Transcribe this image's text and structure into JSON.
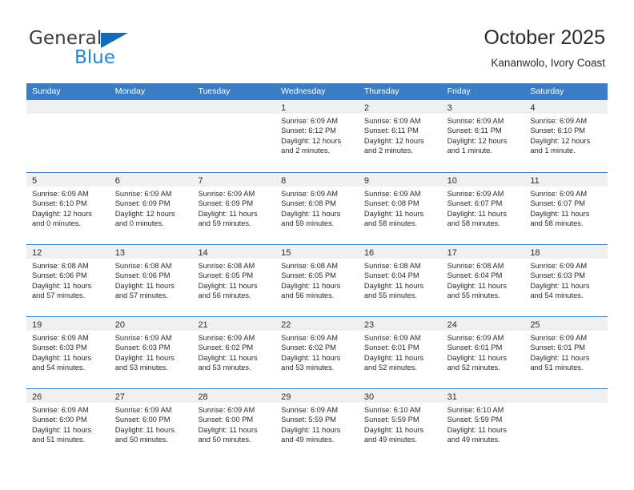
{
  "brand": {
    "name_top": "General",
    "name_bottom": "Blue",
    "triangle_color": "#0f6cb6",
    "blue_text_color": "#1f87d8"
  },
  "header": {
    "title": "October 2025",
    "subtitle": "Kananwolo, Ivory Coast"
  },
  "theme": {
    "header_blue": "#3b7dc4",
    "num_band_gray": "#f0f0f0",
    "text_color": "#2b2b2b"
  },
  "weekdays": [
    "Sunday",
    "Monday",
    "Tuesday",
    "Wednesday",
    "Thursday",
    "Friday",
    "Saturday"
  ],
  "weeks": [
    [
      {
        "day": ""
      },
      {
        "day": ""
      },
      {
        "day": ""
      },
      {
        "day": "1",
        "sunrise": "Sunrise: 6:09 AM",
        "sunset": "Sunset: 6:12 PM",
        "daylight_1": "Daylight: 12 hours",
        "daylight_2": "and 2 minutes."
      },
      {
        "day": "2",
        "sunrise": "Sunrise: 6:09 AM",
        "sunset": "Sunset: 6:11 PM",
        "daylight_1": "Daylight: 12 hours",
        "daylight_2": "and 2 minutes."
      },
      {
        "day": "3",
        "sunrise": "Sunrise: 6:09 AM",
        "sunset": "Sunset: 6:11 PM",
        "daylight_1": "Daylight: 12 hours",
        "daylight_2": "and 1 minute."
      },
      {
        "day": "4",
        "sunrise": "Sunrise: 6:09 AM",
        "sunset": "Sunset: 6:10 PM",
        "daylight_1": "Daylight: 12 hours",
        "daylight_2": "and 1 minute."
      }
    ],
    [
      {
        "day": "5",
        "sunrise": "Sunrise: 6:09 AM",
        "sunset": "Sunset: 6:10 PM",
        "daylight_1": "Daylight: 12 hours",
        "daylight_2": "and 0 minutes."
      },
      {
        "day": "6",
        "sunrise": "Sunrise: 6:09 AM",
        "sunset": "Sunset: 6:09 PM",
        "daylight_1": "Daylight: 12 hours",
        "daylight_2": "and 0 minutes."
      },
      {
        "day": "7",
        "sunrise": "Sunrise: 6:09 AM",
        "sunset": "Sunset: 6:09 PM",
        "daylight_1": "Daylight: 11 hours",
        "daylight_2": "and 59 minutes."
      },
      {
        "day": "8",
        "sunrise": "Sunrise: 6:09 AM",
        "sunset": "Sunset: 6:08 PM",
        "daylight_1": "Daylight: 11 hours",
        "daylight_2": "and 59 minutes."
      },
      {
        "day": "9",
        "sunrise": "Sunrise: 6:09 AM",
        "sunset": "Sunset: 6:08 PM",
        "daylight_1": "Daylight: 11 hours",
        "daylight_2": "and 58 minutes."
      },
      {
        "day": "10",
        "sunrise": "Sunrise: 6:09 AM",
        "sunset": "Sunset: 6:07 PM",
        "daylight_1": "Daylight: 11 hours",
        "daylight_2": "and 58 minutes."
      },
      {
        "day": "11",
        "sunrise": "Sunrise: 6:09 AM",
        "sunset": "Sunset: 6:07 PM",
        "daylight_1": "Daylight: 11 hours",
        "daylight_2": "and 58 minutes."
      }
    ],
    [
      {
        "day": "12",
        "sunrise": "Sunrise: 6:08 AM",
        "sunset": "Sunset: 6:06 PM",
        "daylight_1": "Daylight: 11 hours",
        "daylight_2": "and 57 minutes."
      },
      {
        "day": "13",
        "sunrise": "Sunrise: 6:08 AM",
        "sunset": "Sunset: 6:06 PM",
        "daylight_1": "Daylight: 11 hours",
        "daylight_2": "and 57 minutes."
      },
      {
        "day": "14",
        "sunrise": "Sunrise: 6:08 AM",
        "sunset": "Sunset: 6:05 PM",
        "daylight_1": "Daylight: 11 hours",
        "daylight_2": "and 56 minutes."
      },
      {
        "day": "15",
        "sunrise": "Sunrise: 6:08 AM",
        "sunset": "Sunset: 6:05 PM",
        "daylight_1": "Daylight: 11 hours",
        "daylight_2": "and 56 minutes."
      },
      {
        "day": "16",
        "sunrise": "Sunrise: 6:08 AM",
        "sunset": "Sunset: 6:04 PM",
        "daylight_1": "Daylight: 11 hours",
        "daylight_2": "and 55 minutes."
      },
      {
        "day": "17",
        "sunrise": "Sunrise: 6:08 AM",
        "sunset": "Sunset: 6:04 PM",
        "daylight_1": "Daylight: 11 hours",
        "daylight_2": "and 55 minutes."
      },
      {
        "day": "18",
        "sunrise": "Sunrise: 6:09 AM",
        "sunset": "Sunset: 6:03 PM",
        "daylight_1": "Daylight: 11 hours",
        "daylight_2": "and 54 minutes."
      }
    ],
    [
      {
        "day": "19",
        "sunrise": "Sunrise: 6:09 AM",
        "sunset": "Sunset: 6:03 PM",
        "daylight_1": "Daylight: 11 hours",
        "daylight_2": "and 54 minutes."
      },
      {
        "day": "20",
        "sunrise": "Sunrise: 6:09 AM",
        "sunset": "Sunset: 6:03 PM",
        "daylight_1": "Daylight: 11 hours",
        "daylight_2": "and 53 minutes."
      },
      {
        "day": "21",
        "sunrise": "Sunrise: 6:09 AM",
        "sunset": "Sunset: 6:02 PM",
        "daylight_1": "Daylight: 11 hours",
        "daylight_2": "and 53 minutes."
      },
      {
        "day": "22",
        "sunrise": "Sunrise: 6:09 AM",
        "sunset": "Sunset: 6:02 PM",
        "daylight_1": "Daylight: 11 hours",
        "daylight_2": "and 53 minutes."
      },
      {
        "day": "23",
        "sunrise": "Sunrise: 6:09 AM",
        "sunset": "Sunset: 6:01 PM",
        "daylight_1": "Daylight: 11 hours",
        "daylight_2": "and 52 minutes."
      },
      {
        "day": "24",
        "sunrise": "Sunrise: 6:09 AM",
        "sunset": "Sunset: 6:01 PM",
        "daylight_1": "Daylight: 11 hours",
        "daylight_2": "and 52 minutes."
      },
      {
        "day": "25",
        "sunrise": "Sunrise: 6:09 AM",
        "sunset": "Sunset: 6:01 PM",
        "daylight_1": "Daylight: 11 hours",
        "daylight_2": "and 51 minutes."
      }
    ],
    [
      {
        "day": "26",
        "sunrise": "Sunrise: 6:09 AM",
        "sunset": "Sunset: 6:00 PM",
        "daylight_1": "Daylight: 11 hours",
        "daylight_2": "and 51 minutes."
      },
      {
        "day": "27",
        "sunrise": "Sunrise: 6:09 AM",
        "sunset": "Sunset: 6:00 PM",
        "daylight_1": "Daylight: 11 hours",
        "daylight_2": "and 50 minutes."
      },
      {
        "day": "28",
        "sunrise": "Sunrise: 6:09 AM",
        "sunset": "Sunset: 6:00 PM",
        "daylight_1": "Daylight: 11 hours",
        "daylight_2": "and 50 minutes."
      },
      {
        "day": "29",
        "sunrise": "Sunrise: 6:09 AM",
        "sunset": "Sunset: 5:59 PM",
        "daylight_1": "Daylight: 11 hours",
        "daylight_2": "and 49 minutes."
      },
      {
        "day": "30",
        "sunrise": "Sunrise: 6:10 AM",
        "sunset": "Sunset: 5:59 PM",
        "daylight_1": "Daylight: 11 hours",
        "daylight_2": "and 49 minutes."
      },
      {
        "day": "31",
        "sunrise": "Sunrise: 6:10 AM",
        "sunset": "Sunset: 5:59 PM",
        "daylight_1": "Daylight: 11 hours",
        "daylight_2": "and 49 minutes."
      },
      {
        "day": ""
      }
    ]
  ]
}
